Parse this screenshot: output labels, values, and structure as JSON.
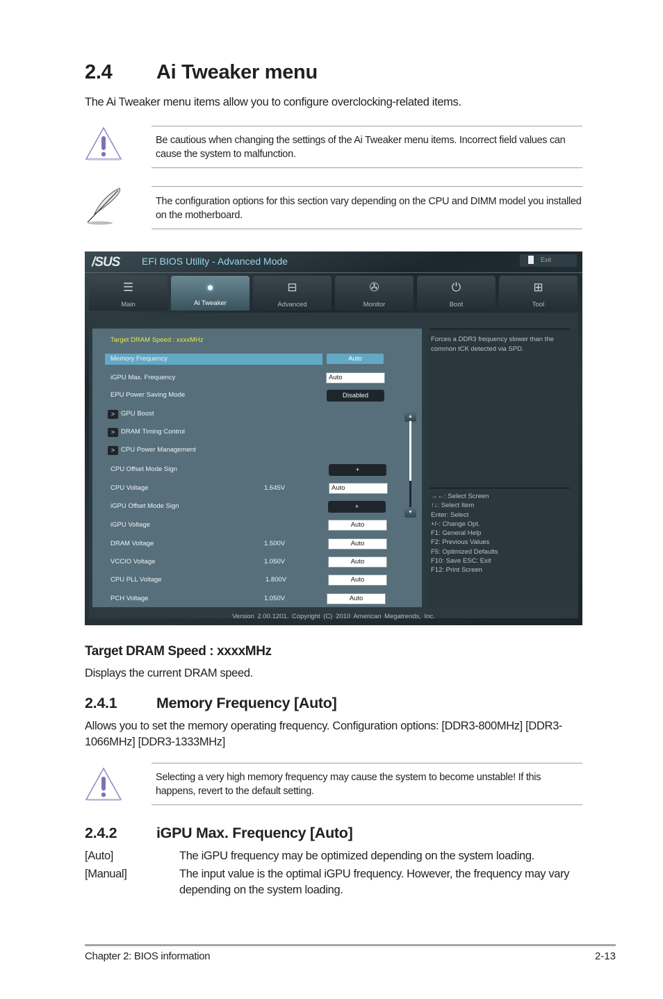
{
  "section": {
    "number": "2.4",
    "title": "Ai Tweaker menu",
    "intro": "The Ai Tweaker menu items allow you to configure overclocking-related items."
  },
  "notes": [
    {
      "icon": "warning-icon",
      "text": "Be cautious when changing the settings of the Ai Tweaker menu items. Incorrect field values can cause the system to malfunction."
    },
    {
      "icon": "note-feather-icon",
      "text": "The configuration options for this section vary depending on the CPU and DIMM model you installed on the motherboard."
    }
  ],
  "bios": {
    "logo": "/SUS",
    "title": "EFI BIOS Utility - Advanced Mode",
    "exit_label": "Exit",
    "tabs": [
      {
        "label": "Main",
        "icon": "list-icon",
        "active": false
      },
      {
        "label": "Ai  Tweaker",
        "icon": "ai-tweaker-icon",
        "active": true
      },
      {
        "label": "Advanced",
        "icon": "advanced-icon",
        "active": false
      },
      {
        "label": "Monitor",
        "icon": "monitor-thermometer-icon",
        "active": false
      },
      {
        "label": "Boot",
        "icon": "power-icon",
        "active": false
      },
      {
        "label": "Tool",
        "icon": "toolbox-icon",
        "active": false
      }
    ],
    "target_dram": "Target DRAM Speed : xxxxMHz",
    "items": [
      {
        "label": "Memory Frequency",
        "value": "",
        "control": "Auto",
        "type": "highlight"
      },
      {
        "label": "iGPU Max. Frequency",
        "value": "",
        "control": "Auto",
        "type": "input"
      },
      {
        "label": "EPU Power Saving Mode",
        "value": "",
        "control": "Disabled",
        "type": "dark"
      },
      {
        "label": "GPU Boost",
        "type": "submenu"
      },
      {
        "label": "DRAM Timing Control",
        "type": "submenu"
      },
      {
        "label": "CPU Power Management",
        "type": "submenu"
      },
      {
        "label": "CPU Offset Mode Sign",
        "value": "",
        "control": "+",
        "type": "dark"
      },
      {
        "label": "CPU Voltage",
        "value": "1.645V",
        "control": "Auto",
        "type": "input"
      },
      {
        "label": "iGPU Offset Mode Sign",
        "value": "",
        "control": "+",
        "type": "dark"
      },
      {
        "label": "iGPU Voltage",
        "value": "",
        "control": "Auto",
        "type": "box"
      },
      {
        "label": "DRAM Voltage",
        "value": "1.500V",
        "control": "Auto",
        "type": "box"
      },
      {
        "label": "VCCIO Voltage",
        "value": "1.050V",
        "control": "Auto",
        "type": "box"
      },
      {
        "label": "CPU PLL Voltage",
        "value": "1.800V",
        "control": "Auto",
        "type": "box"
      },
      {
        "label": "PCH Voltage",
        "value": "1.050V",
        "control": "Auto",
        "type": "box"
      }
    ],
    "submenu_arrow": ">",
    "scroll_up": "▲",
    "scroll_down": "▼",
    "help_description": "Forces a DDR3 frequency slower than the common tCK detected via SPD.",
    "help_keys": [
      "→←:  Select Screen",
      "↑↓:  Select Item",
      "Enter:  Select",
      "+/-:  Change Opt.",
      "F1:  General Help",
      "F2:  Previous Values",
      "F5:  Optimized Defaults",
      "F10:  Save    ESC:  Exit",
      "F12:  Print Screen"
    ],
    "version": "Version  2.00.1201.  Copyright  (C)  2010  American  Megatrends,  Inc."
  },
  "target_dram_section": {
    "heading": "Target DRAM Speed : xxxxMHz",
    "text": "Displays the current DRAM speed."
  },
  "sub1": {
    "number": "2.4.1",
    "title": "Memory Frequency [Auto]",
    "text": "Allows you to set the memory operating frequency. Configuration options: [DDR3-800MHz] [DDR3-1066MHz] [DDR3-1333MHz]",
    "note": "Selecting a very high memory frequency may cause the system to become unstable! If this happens, revert to the default setting."
  },
  "sub2": {
    "number": "2.4.2",
    "title": "iGPU Max. Frequency [Auto]",
    "options": [
      {
        "key": "[Auto]",
        "desc": "The iGPU frequency may be optimized depending on the system loading."
      },
      {
        "key": "[Manual]",
        "desc": "The input value is the optimal iGPU frequency. However, the frequency may vary depending on the system loading."
      }
    ]
  },
  "footer": {
    "chapter": "Chapter 2: BIOS information",
    "page": "2-13"
  }
}
